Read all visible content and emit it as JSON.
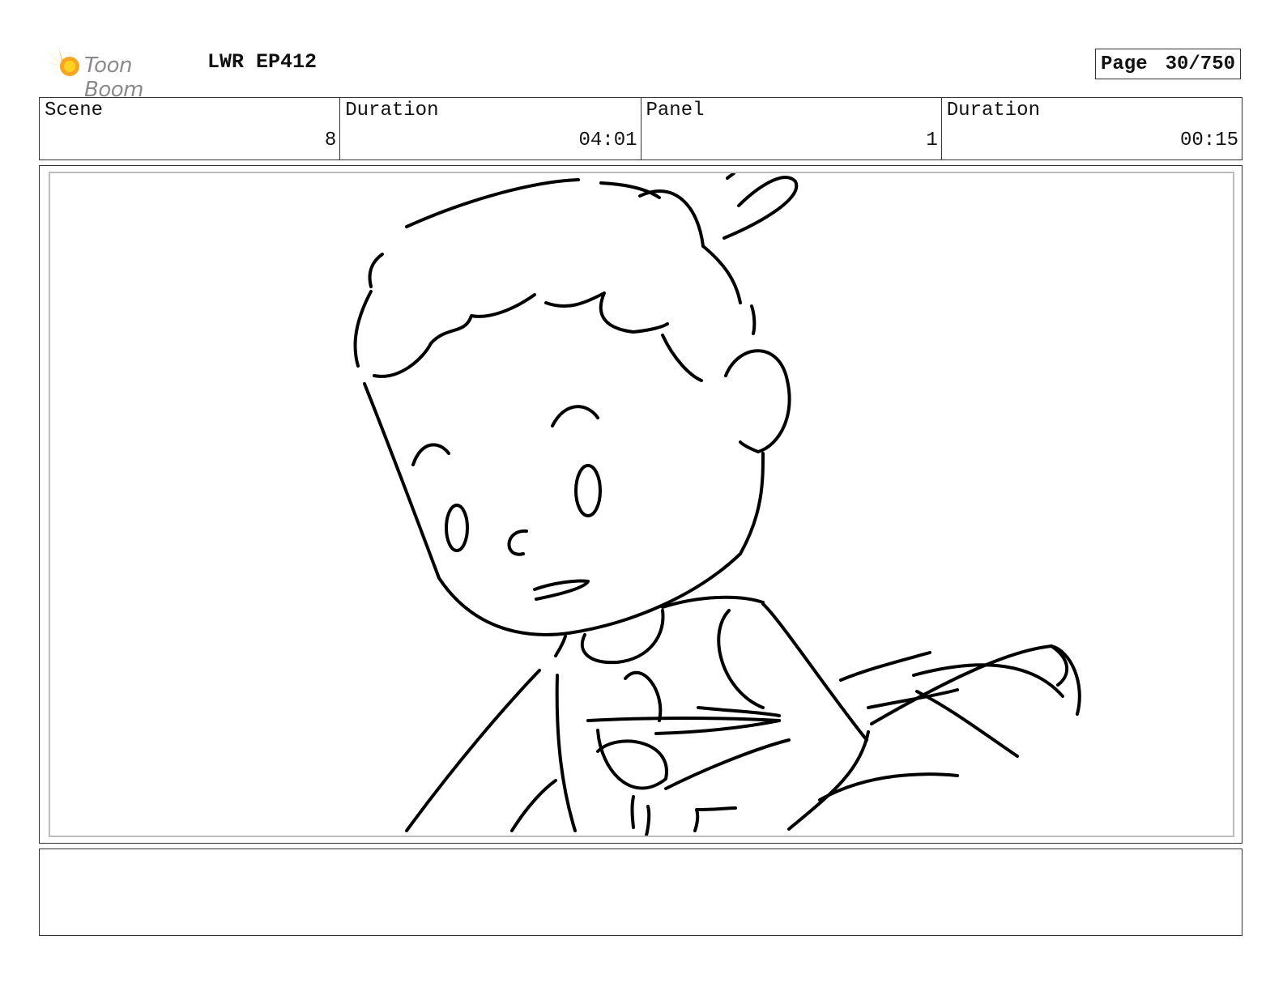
{
  "header": {
    "brand_logo_text": "Toon Boom",
    "project_title": "LWR EP412",
    "page_label": "Page",
    "page_value": "30/750"
  },
  "info": {
    "scene_label": "Scene",
    "scene_value": "8",
    "scene_duration_label": "Duration",
    "scene_duration_value": "04:01",
    "panel_label": "Panel",
    "panel_value": "1",
    "panel_duration_label": "Duration",
    "panel_duration_value": "00:15"
  },
  "notes": {
    "text": ""
  },
  "colors": {
    "logo_orange": "#f5a623",
    "logo_yellow": "#ffd21f",
    "logo_gray": "#8a8a8a"
  }
}
